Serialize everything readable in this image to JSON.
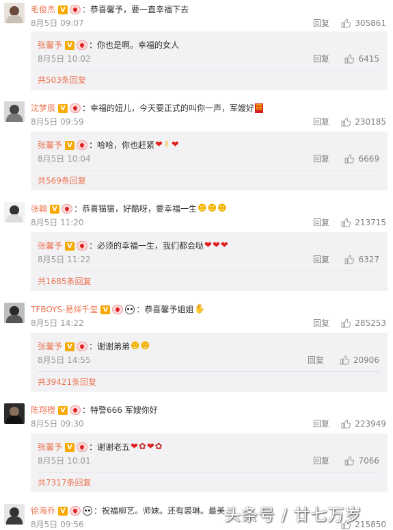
{
  "reply_label": "回复",
  "comments": [
    {
      "user": "毛俊杰",
      "text": "：恭喜馨予，要一直幸福下去",
      "time": "8月5日 09:07",
      "likes": "305861",
      "sub": {
        "user": "张馨予",
        "text": "：你也是啊。幸福的女人",
        "time": "8月5日 10:02",
        "likes": "6415"
      },
      "total": "共503条回复"
    },
    {
      "user": "沈梦辰",
      "text": "：幸福的妞儿，今天要正式的叫你一声，军嫂好",
      "time": "8月5日 09:59",
      "likes": "230185",
      "sub": {
        "user": "张馨予",
        "text": "：哈哈，你也赶紧",
        "time": "8月5日 10:04",
        "likes": "6669"
      },
      "total": "共569条回复"
    },
    {
      "user": "张翰",
      "text": "：恭喜猫猫，好酷呀，要幸福一生",
      "time": "8月5日 11:20",
      "likes": "213715",
      "sub": {
        "user": "张馨予",
        "text": "：必须的幸福一生，我们都会哒",
        "time": "8月5日 11:22",
        "likes": "6327"
      },
      "total": "共1685条回复"
    },
    {
      "user": "TFBOYS-易烊千玺",
      "text": "：恭喜馨予姐姐",
      "time": "8月5日 14:22",
      "likes": "285253",
      "sub": {
        "user": "张馨予",
        "text": "：谢谢弟弟",
        "time": "8月5日 14:55",
        "likes": "20906"
      },
      "total": "共39421条回复"
    },
    {
      "user": "陈翔橙",
      "text": "：特警666 军嫂你好",
      "time": "8月5日 09:30",
      "likes": "223949",
      "sub": {
        "user": "张馨予",
        "text": "：谢谢老五",
        "time": "8月5日 10:01",
        "likes": "7066"
      },
      "total": "共7317条回复"
    },
    {
      "user": "徐海乔",
      "text": "：祝福柳艺。师妹。还有裘琳。最美",
      "time": "8月5日 09:56",
      "likes": "215850"
    }
  ],
  "watermark": "头条号 / 廿七万岁",
  "colors": {
    "username": "#eb7350",
    "reply_box": "#f2f2f5",
    "heart": "#e02020"
  }
}
